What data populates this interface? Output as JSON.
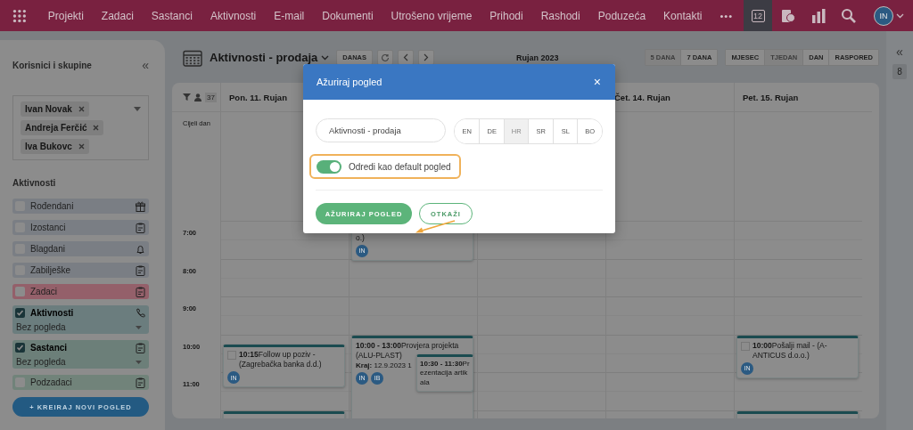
{
  "top_nav": {
    "items": [
      "Projekti",
      "Zadaci",
      "Sastanci",
      "Aktivnosti",
      "E-mail",
      "Dokumenti",
      "Utrošeno vrijeme",
      "Prihodi",
      "Rashodi",
      "Poduzeća",
      "Kontakti"
    ],
    "more": "•••",
    "tools": [
      {
        "selected": true
      },
      {
        "selected": false
      },
      {
        "selected": false
      },
      {
        "selected": false
      }
    ],
    "calendar_day": "12",
    "avatar": "IN"
  },
  "sidebar": {
    "title": "Korisnici i skupine",
    "collapse": "«",
    "users": [
      "Ivan Novak",
      "Andreja Ferčić",
      "Iva Bukovc"
    ],
    "activities_title": "Aktivnosti",
    "activities": [
      {
        "kind": "simple",
        "label": "Rođendani",
        "checked": false,
        "color": "#7a7e84"
      },
      {
        "kind": "simple",
        "label": "Izostanci",
        "checked": false,
        "color": "#7a7e84"
      },
      {
        "kind": "simple",
        "label": "Blagdani",
        "checked": false,
        "color": "#7a7e84"
      },
      {
        "kind": "simple",
        "label": "Zabilješke",
        "checked": false,
        "color": "#7a7e84"
      },
      {
        "kind": "simple",
        "label": "Zadaci",
        "checked": false,
        "color": "#94606a"
      },
      {
        "kind": "with_view",
        "label": "Aktivnosti",
        "checked": true,
        "color": "#6b7d7e",
        "view": "Bez pogleda"
      },
      {
        "kind": "with_view",
        "label": "Sastanci",
        "checked": true,
        "color": "#6c7f79",
        "view": "Bez pogleda"
      },
      {
        "kind": "simple",
        "label": "Podzadaci",
        "checked": false,
        "color": "#71837a"
      }
    ],
    "create_button": "+ KREIRAJ NOVI POGLED"
  },
  "toolbar": {
    "title": "Aktivnosti - prodaja",
    "today": "DANAS",
    "month": "Rujan 2023",
    "ranges": [
      {
        "label": "5 DANA",
        "selected": true
      },
      {
        "label": "7 DANA",
        "selected": false
      }
    ],
    "views": [
      {
        "label": "MJESEC",
        "selected": false
      },
      {
        "label": "TJEDAN",
        "selected": true
      },
      {
        "label": "DAN",
        "selected": false
      },
      {
        "label": "RASPORED",
        "selected": false
      }
    ]
  },
  "right_strip": {
    "collapse": "«",
    "badge": "8"
  },
  "calendar": {
    "count": "37",
    "all_day": "Cijeli dan",
    "hours": [
      "7:00",
      "8:00",
      "9:00",
      "10:00",
      "11:00"
    ],
    "days": [
      {
        "label": "Pon. 11. Rujan",
        "events": [
          {
            "kind": "timed",
            "checked": false,
            "time": "10:15",
            "title": "Follow up poziv - (Zagrebačka banka d.d.)",
            "avatars": [
              "IN"
            ]
          },
          {
            "kind": "cut"
          }
        ]
      },
      {
        "events": [
          {
            "kind": "partial",
            "title": "o.)",
            "avatars": [
              "IN"
            ]
          },
          {
            "kind": "timed",
            "time": "10:00 - 13:00",
            "title": "Provjera projekta (ALU-PLAST)",
            "note": "**Kraj:** 12.9.2023 1",
            "avatars": [
              "IN",
              "IB"
            ]
          },
          {
            "kind": "overlap",
            "time": "10:30 - 11:30",
            "title": "Prezentacija artikala"
          }
        ]
      },
      {
        "label": "Čet. 14. Rujan"
      },
      {
        "label": "Pet. 15. Rujan",
        "events": [
          {
            "kind": "timed",
            "checked": false,
            "time": "10:00",
            "title": "Pošalji mail - (A-ANTICUS d.o.o.)",
            "avatars": [
              "IN"
            ]
          },
          {
            "kind": "cut"
          }
        ]
      }
    ]
  },
  "modal": {
    "title": "Ažuriraj pogled",
    "close": "×",
    "name_value": "Aktivnosti - prodaja",
    "languages": [
      {
        "label": "EN",
        "selected": false
      },
      {
        "label": "DE",
        "selected": false
      },
      {
        "label": "HR",
        "selected": true
      },
      {
        "label": "SR",
        "selected": false
      },
      {
        "label": "SL",
        "selected": false
      },
      {
        "label": "BO",
        "selected": false
      }
    ],
    "default_toggle": {
      "label": "Odredi kao default pogled",
      "on": true
    },
    "buttons": [
      "AŽURIRAJ POGLED",
      "OTKAŽI"
    ]
  }
}
